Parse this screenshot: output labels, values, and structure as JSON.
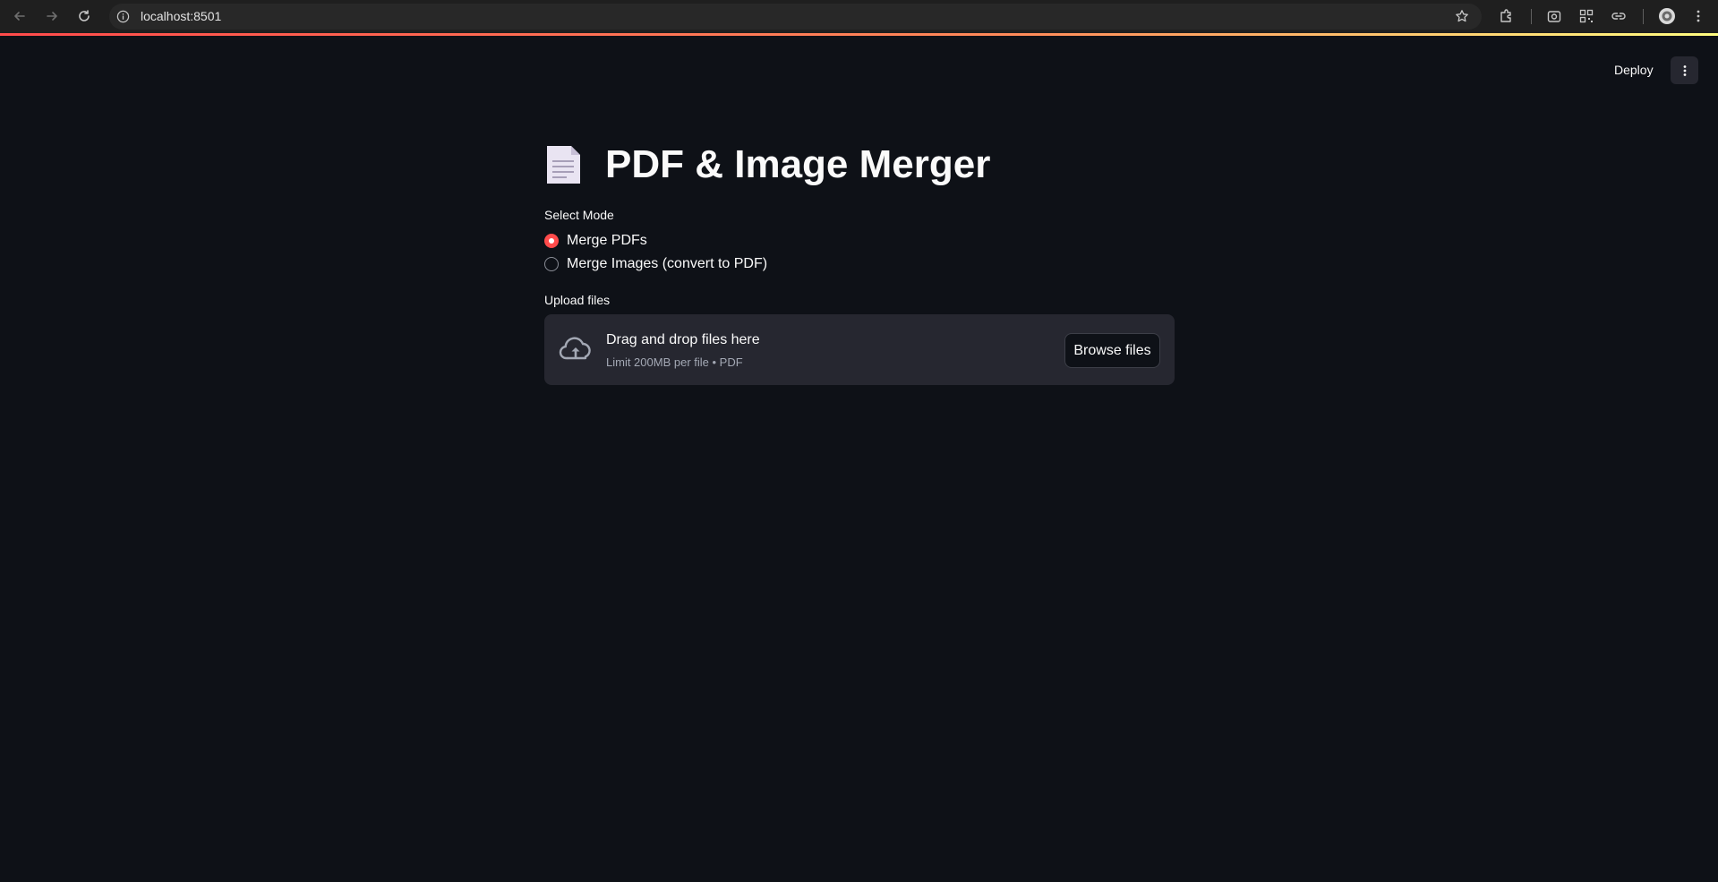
{
  "browser": {
    "url": "localhost:8501"
  },
  "header": {
    "deploy_label": "Deploy"
  },
  "main": {
    "title": "PDF & Image Merger",
    "mode_label": "Select Mode",
    "modes": [
      {
        "label": "Merge PDFs",
        "selected": true
      },
      {
        "label": "Merge Images (convert to PDF)",
        "selected": false
      }
    ],
    "upload_label": "Upload files",
    "dropzone": {
      "title": "Drag and drop files here",
      "subtitle": "Limit 200MB per file • PDF",
      "browse_label": "Browse files"
    }
  },
  "colors": {
    "background": "#0e1117",
    "accent": "#ff4b4b",
    "panel": "#262730",
    "text": "#fafafa"
  }
}
